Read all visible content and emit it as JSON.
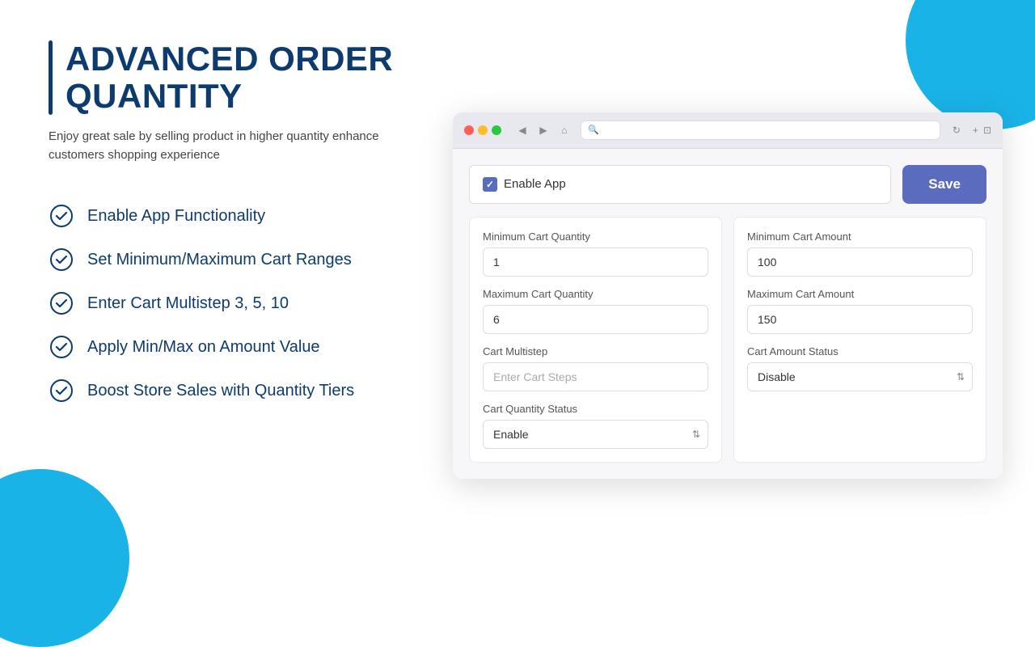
{
  "page": {
    "title": "ADVANCED ORDER QUANTITY",
    "subtitle": "Enjoy great sale by selling product in higher quantity enhance customers shopping experience"
  },
  "features": [
    {
      "id": "feat-1",
      "label": "Enable App Functionality"
    },
    {
      "id": "feat-2",
      "label": "Set Minimum/Maximum Cart Ranges"
    },
    {
      "id": "feat-3",
      "label": "Enter Cart Multistep 3, 5, 10"
    },
    {
      "id": "feat-4",
      "label": "Apply Min/Max on Amount Value"
    },
    {
      "id": "feat-5",
      "label": "Boost Store Sales with Quantity Tiers"
    }
  ],
  "browser": {
    "enable_app_label": "Enable App",
    "save_button": "Save",
    "left_column": {
      "fields": [
        {
          "id": "min-cart-qty",
          "label": "Minimum Cart Quantity",
          "value": "1",
          "placeholder": ""
        },
        {
          "id": "max-cart-qty",
          "label": "Maximum Cart Quantity",
          "value": "6",
          "placeholder": ""
        },
        {
          "id": "cart-multistep",
          "label": "Cart Multistep",
          "value": "",
          "placeholder": "Enter Cart Steps"
        }
      ],
      "select": {
        "id": "cart-qty-status",
        "label": "Cart Quantity Status",
        "value": "Enable",
        "options": [
          "Enable",
          "Disable"
        ]
      }
    },
    "right_column": {
      "fields": [
        {
          "id": "min-cart-amount",
          "label": "Minimum Cart Amount",
          "value": "100",
          "placeholder": ""
        },
        {
          "id": "max-cart-amount",
          "label": "Maximum Cart Amount",
          "value": "150",
          "placeholder": ""
        }
      ],
      "select": {
        "id": "cart-amount-status",
        "label": "Cart Amount Status",
        "value": "Disable",
        "options": [
          "Enable",
          "Disable"
        ]
      }
    }
  },
  "colors": {
    "accent": "#1ab3e8",
    "navy": "#0d3b6e",
    "purple": "#5b6bbd"
  }
}
